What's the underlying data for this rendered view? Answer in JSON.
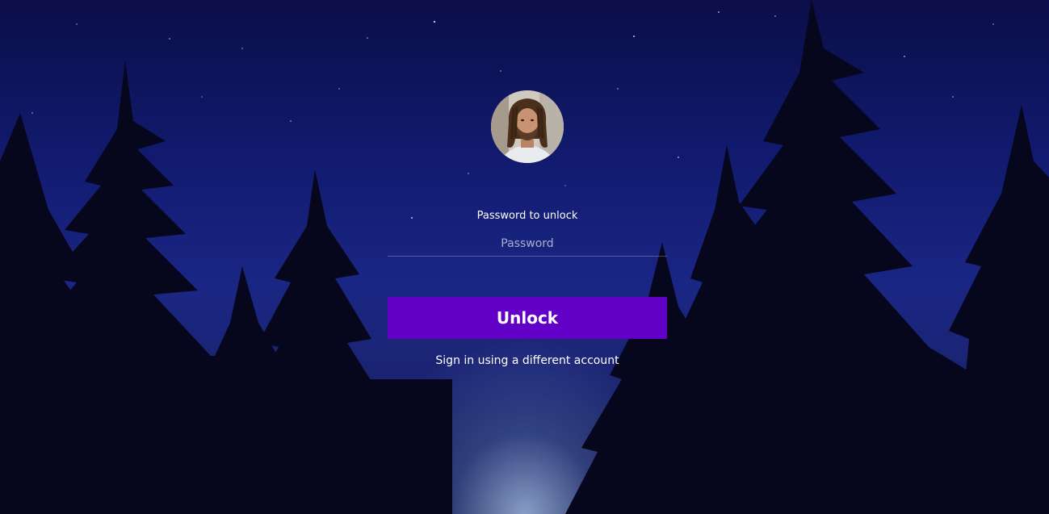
{
  "lock_screen": {
    "password_label": "Password to unlock",
    "password_placeholder": "Password",
    "password_value": "",
    "unlock_label": "Unlock",
    "switch_account_label": "Sign in using a different account"
  },
  "colors": {
    "accent": "#6200c8",
    "background_top": "#0b0e48",
    "background_mid": "#1a2684",
    "text": "#ffffff"
  }
}
